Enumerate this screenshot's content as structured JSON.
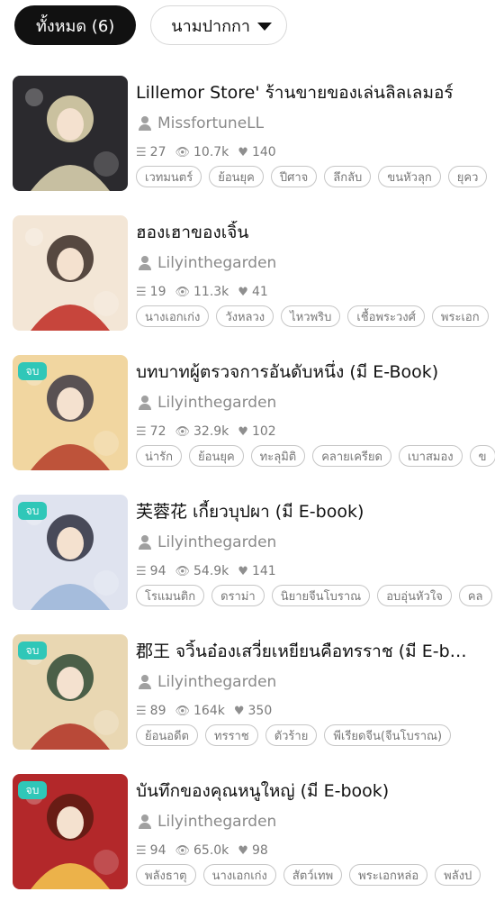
{
  "filters": {
    "all_label": "ทั้งหมด (6)",
    "sort_label": "นามปากกา"
  },
  "novels": [
    {
      "title": "Lillemor Store' ร้านขายของเล่นลิลเลมอร์",
      "author": "MissfortuneLL",
      "chapters": "27",
      "views": "10.7k",
      "likes": "140",
      "completed": false,
      "completed_label": "",
      "tags": [
        "เวทมนตร์",
        "ย้อนยุค",
        "ปีศาจ",
        "ลึกลับ",
        "ขนหัวลุก",
        "ยุคว"
      ],
      "cover": {
        "bg": "#2b2a2e",
        "accent": "#d8cfae",
        "hair": "#e6dcb3"
      }
    },
    {
      "title": "ฮองเฮาของเจิ้น",
      "author": "Lilyinthegarden",
      "chapters": "19",
      "views": "11.3k",
      "likes": "41",
      "completed": false,
      "completed_label": "",
      "tags": [
        "นางเอกเก่ง",
        "วังหลวง",
        "ไหวพริบ",
        "เชื้อพระวงศ์",
        "พระเอก"
      ],
      "cover": {
        "bg": "#f3e6d6",
        "accent": "#c2332b",
        "hair": "#3a2b26"
      }
    },
    {
      "title": "บทบาทผู้ตรวจการอันดับหนึ่ง (มี E-Book)",
      "author": "Lilyinthegarden",
      "chapters": "72",
      "views": "32.9k",
      "likes": "102",
      "completed": true,
      "completed_label": "จบ",
      "tags": [
        "น่ารัก",
        "ย้อนยุค",
        "ทะลุมิติ",
        "คลายเครียด",
        "เบาสมอง",
        "ข"
      ],
      "cover": {
        "bg": "#f1d6a0",
        "accent": "#b8452f",
        "hair": "#3e3a45"
      }
    },
    {
      "title": "芙蓉花 เกี้ยวบุปผา (มี E-book)",
      "author": "Lilyinthegarden",
      "chapters": "94",
      "views": "54.9k",
      "likes": "141",
      "completed": true,
      "completed_label": "จบ",
      "tags": [
        "โรแมนติก",
        "ดราม่า",
        "นิยายจีนโบราณ",
        "อบอุ่นหัวใจ",
        "คล"
      ],
      "cover": {
        "bg": "#dfe3ef",
        "accent": "#9fb7d9",
        "hair": "#2e2f3e"
      }
    },
    {
      "title": "郡王 จวิ้นอ๋องเสวี่ยเหยียนคือทรราช (มี E-book)",
      "author": "Lilyinthegarden",
      "chapters": "89",
      "views": "164k",
      "likes": "350",
      "completed": true,
      "completed_label": "จบ",
      "tags": [
        "ย้อนอดีต",
        "ทรราช",
        "ตัวร้าย",
        "พีเรียดจีน(จีนโบราณ)"
      ],
      "cover": {
        "bg": "#e9d7b2",
        "accent": "#b43a2a",
        "hair": "#2f4a35"
      }
    },
    {
      "title": "บันทึกของคุณหนูใหญ่ (มี E-book)",
      "author": "Lilyinthegarden",
      "chapters": "94",
      "views": "65.0k",
      "likes": "98",
      "completed": true,
      "completed_label": "จบ",
      "tags": [
        "พลังธาตุ",
        "นางเอกเก่ง",
        "สัตว์เทพ",
        "พระเอกหล่อ",
        "พลังป"
      ],
      "cover": {
        "bg": "#b3282a",
        "accent": "#f2c14e",
        "hair": "#5a1a12"
      }
    }
  ]
}
